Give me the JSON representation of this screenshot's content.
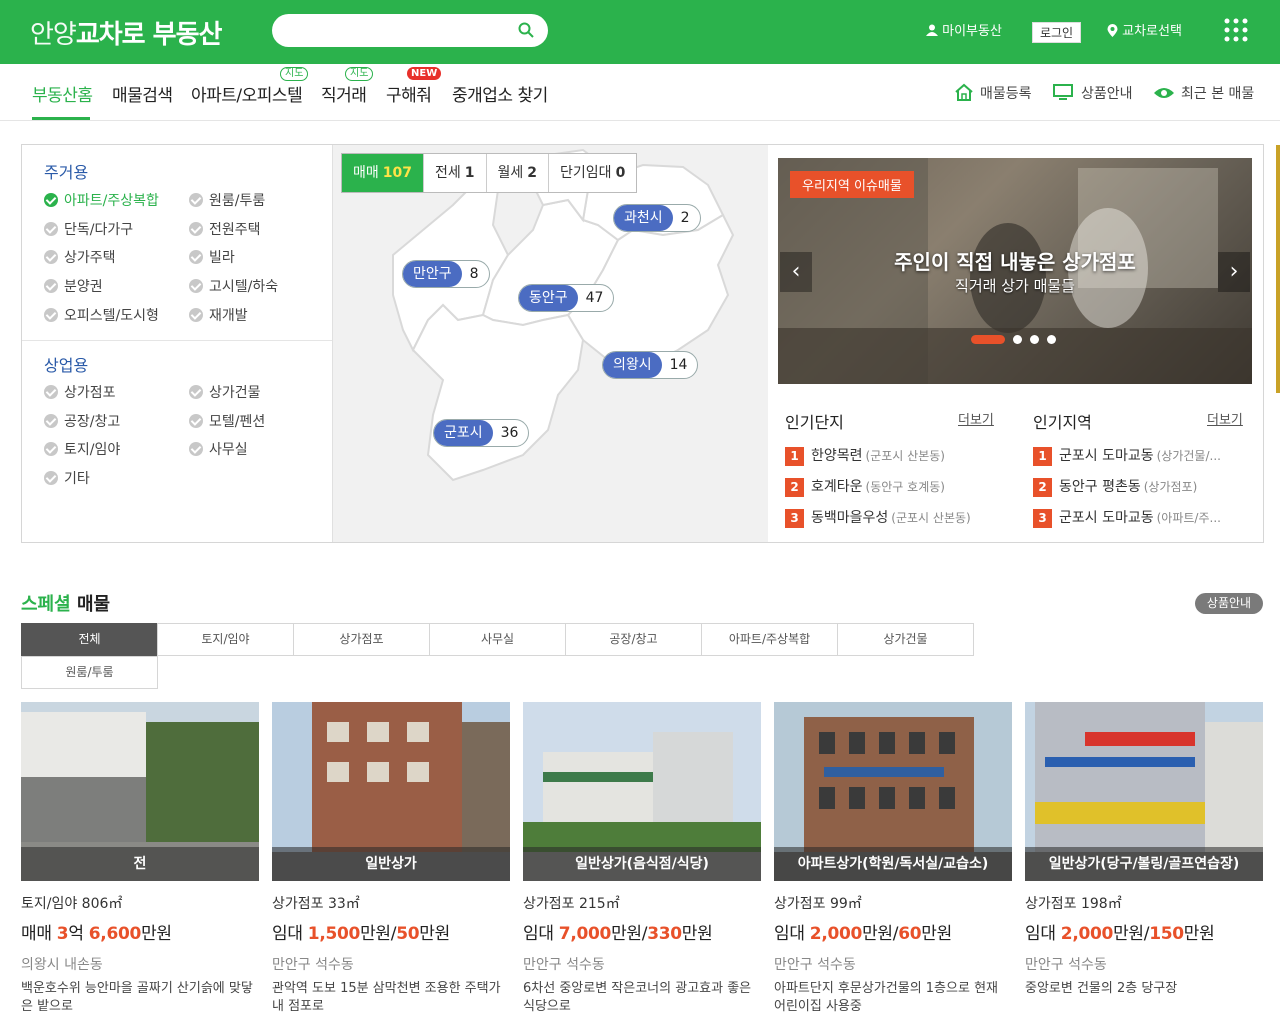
{
  "header": {
    "logo_part1": "안양",
    "logo_part2": "교차로 부동산",
    "search_placeholder": "",
    "my_label": "마이부동산",
    "login_label": "로그인",
    "region_select_label": "교차로선택"
  },
  "nav": {
    "items": [
      {
        "label": "부동산홈"
      },
      {
        "label": "매물검색"
      },
      {
        "label": "아파트/오피스텔",
        "badge": "지도"
      },
      {
        "label": "직거래",
        "badge": "지도"
      },
      {
        "label": "구해줘",
        "badge": "NEW"
      },
      {
        "label": "중개업소 찾기"
      }
    ],
    "right": {
      "register": "매물등록",
      "products": "상품안내",
      "recent": "최근 본 매물"
    }
  },
  "categories": {
    "residential_title": "주거용",
    "residential": [
      "아파트/주상복합",
      "원룸/투룸",
      "단독/다가구",
      "전원주택",
      "상가주택",
      "빌라",
      "분양권",
      "고시텔/하숙",
      "오피스텔/도시형",
      "재개발"
    ],
    "commercial_title": "상업용",
    "commercial": [
      "상가점포",
      "상가건물",
      "공장/창고",
      "모텔/펜션",
      "토지/임야",
      "사무실",
      "기타"
    ]
  },
  "map": {
    "deal_tabs": [
      {
        "label": "매매",
        "count": "107"
      },
      {
        "label": "전세",
        "count": "1"
      },
      {
        "label": "월세",
        "count": "2"
      },
      {
        "label": "단기임대",
        "count": "0"
      }
    ],
    "regions": [
      {
        "name": "과천시",
        "count": "2"
      },
      {
        "name": "만안구",
        "count": "8"
      },
      {
        "name": "동안구",
        "count": "47"
      },
      {
        "name": "의왕시",
        "count": "14"
      },
      {
        "name": "군포시",
        "count": "36"
      }
    ]
  },
  "banner": {
    "tag": "우리지역 이슈매물",
    "title": "주인이 직접 내놓은 상가점포",
    "subtitle": "직거래 상가 매물들"
  },
  "popular_complex": {
    "title": "인기단지",
    "more": "더보기",
    "items": [
      {
        "num": "1",
        "name": "한양목련",
        "loc": "(군포시 산본동)"
      },
      {
        "num": "2",
        "name": "호계타운",
        "loc": "(동안구 호계동)"
      },
      {
        "num": "3",
        "name": "동백마을우성",
        "loc": "(군포시 산본동)"
      }
    ]
  },
  "popular_region": {
    "title": "인기지역",
    "more": "더보기",
    "items": [
      {
        "num": "1",
        "name": "군포시 도마교동",
        "loc": "(상가건물/..."
      },
      {
        "num": "2",
        "name": "동안구 평촌동",
        "loc": "(상가점포)"
      },
      {
        "num": "3",
        "name": "군포시 도마교동",
        "loc": "(아파트/주..."
      }
    ]
  },
  "special": {
    "title_green": "스페셜",
    "title_rest": " 매물",
    "product_btn": "상품안내",
    "tabs": [
      "전체",
      "토지/임야",
      "상가점포",
      "사무실",
      "공장/창고",
      "아파트/주상복합",
      "상가건물",
      "원룸/투룸"
    ],
    "cards": [
      {
        "caption": "전",
        "type": "토지/임야 806㎡",
        "p1": "매매 ",
        "h1": "3",
        "p2": "억 ",
        "h2": "6,600",
        "p3": "만원",
        "h3": "",
        "p4": "",
        "loc": "의왕시 내손동",
        "desc": "백운호수위 능안마을 골짜기 산기슭에 맞닿은 밭으로"
      },
      {
        "caption": "일반상가",
        "type": "상가점포 33㎡",
        "p1": "임대 ",
        "h1": "1,500",
        "p2": "만원/",
        "h2": "50",
        "p3": "만원",
        "h3": "",
        "p4": "",
        "loc": "만안구 석수동",
        "desc": "관악역 도보 15분 삼막천변 조용한 주택가내 점포로"
      },
      {
        "caption": "일반상가(음식점/식당)",
        "type": "상가점포 215㎡",
        "p1": "임대 ",
        "h1": "7,000",
        "p2": "만원/",
        "h2": "330",
        "p3": "만원",
        "h3": "",
        "p4": "",
        "loc": "만안구 석수동",
        "desc": "6차선 중앙로변 작은코너의 광고효과 좋은 식당으로"
      },
      {
        "caption": "아파트상가(학원/독서실/교습소)",
        "type": "상가점포 99㎡",
        "p1": "임대 ",
        "h1": "2,000",
        "p2": "만원/",
        "h2": "60",
        "p3": "만원",
        "h3": "",
        "p4": "",
        "loc": "만안구 석수동",
        "desc": "아파트단지 후문상가건물의 1층으로 현재 어린이집 사용중"
      },
      {
        "caption": "일반상가(당구/볼링/골프연습장)",
        "type": "상가점포 198㎡",
        "p1": "임대 ",
        "h1": "2,000",
        "p2": "만원/",
        "h2": "150",
        "p3": "만원",
        "h3": "",
        "p4": "",
        "loc": "만안구 석수동",
        "desc": "중앙로변 건물의 2층 당구장"
      }
    ]
  },
  "colors": {
    "brand": "#2bb24c",
    "accent": "#e8512a",
    "region_pill": "#4b6cc2"
  }
}
